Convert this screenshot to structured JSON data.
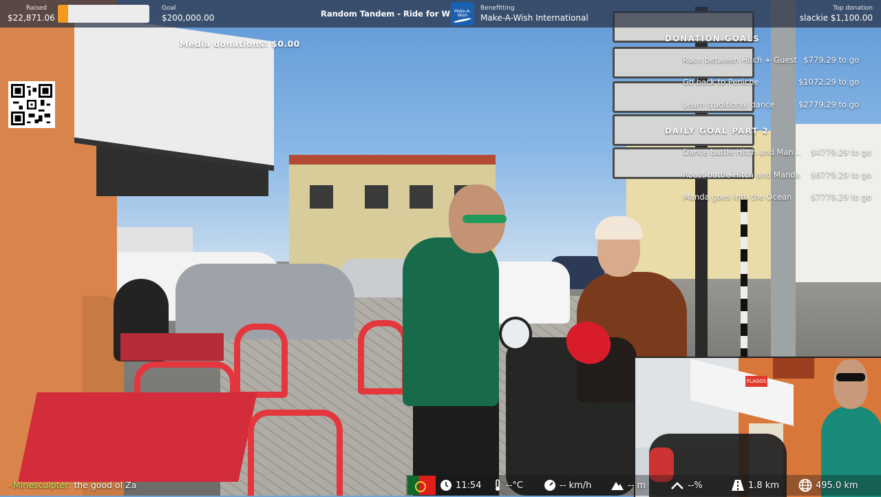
{
  "topbar": {
    "raised_label": "Raised",
    "raised_value": "$22,871.06",
    "raised_progress_fraction": 0.114,
    "goal_label": "Goal",
    "goal_value": "$200,000.00",
    "stream_title": "Random Tandem - Ride for Wishes",
    "charity_logo_text": "Make-A-Wish",
    "benefitting_label": "Benefitting",
    "charity_name": "Make-A-Wish International",
    "top_donation_label": "Top donation",
    "top_donation_value": "slackie $1,100.00"
  },
  "media_donations": "Media donations: $0.00",
  "donation_goals": {
    "header": "DONATION GOALS",
    "items": [
      {
        "name": "Race between Hitch + Guest",
        "amount": "$779.29 to go"
      },
      {
        "name": "Go back to Peniche",
        "amount": "$1072.29 to go"
      },
      {
        "name": "Learn traditional dance",
        "amount": "$2779.29 to go"
      }
    ]
  },
  "daily_goals": {
    "header": "DAILY GOAL PART 2",
    "items": [
      {
        "name": "Dance battle Hitch and Man...",
        "amount": "$4779.29 to go"
      },
      {
        "name": "Roast battle Hitch and Manda",
        "amount": "$6779.29 to go"
      },
      {
        "name": "Manda goes into the Ocean",
        "amount": "$7779.29 to go"
      }
    ]
  },
  "pip_sign_text": "FLAGGS",
  "chat": {
    "badge_icon": "streamer-badge-icon",
    "username": "Minesculpter:",
    "message": "the good ol Za"
  },
  "bottom_bar": {
    "flag_icon": "portugal-flag-icon",
    "time": "11:54",
    "temperature": "--°C",
    "speed": "-- km/h",
    "altitude": "-- m",
    "incline": "--%",
    "distance_trip": "1.8 km",
    "distance_total": "495.0 km"
  },
  "colors": {
    "progress_fill": "#f59a1e",
    "topbar_bg": "#283042",
    "chat_username": "#b8e35a"
  }
}
